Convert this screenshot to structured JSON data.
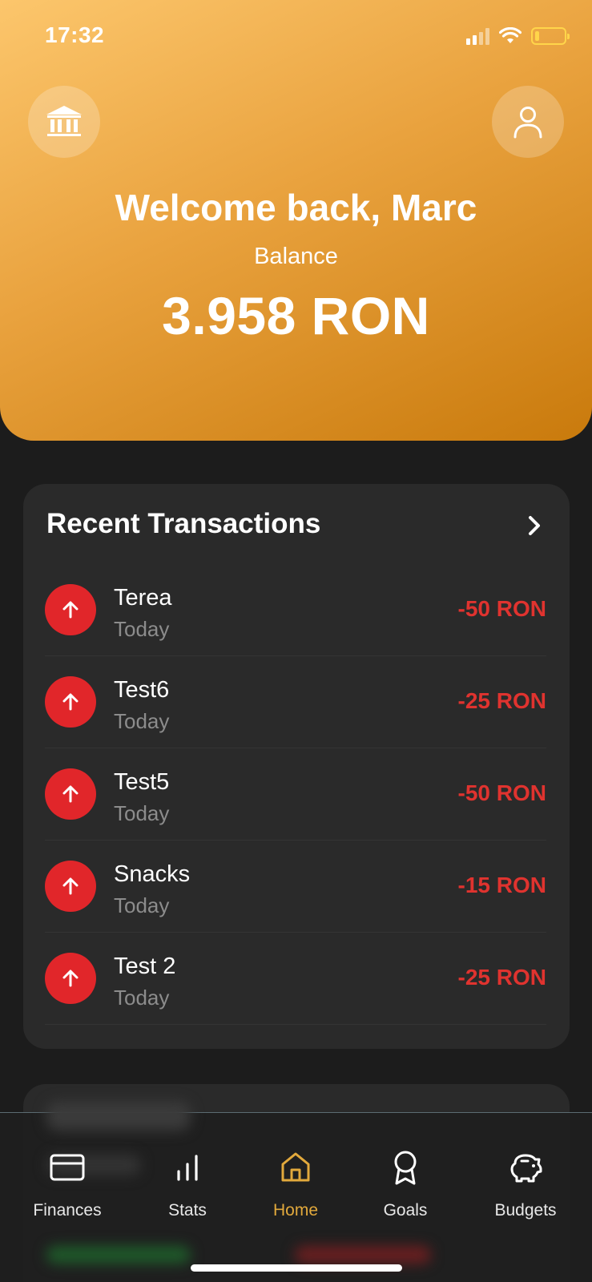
{
  "status_bar": {
    "time": "17:32",
    "signal_icon": "cellular-signal-icon",
    "wifi_icon": "wifi-icon",
    "battery_icon": "battery-low-icon",
    "battery_color": "#ffd54a"
  },
  "header": {
    "bank_icon": "bank-icon",
    "profile_icon": "user-icon",
    "welcome": "Welcome back, Marc",
    "balance_label": "Balance",
    "balance_value": "3.958 RON",
    "gradient_colors": [
      "#fcc66c",
      "#e9a23e",
      "#c97a0c"
    ]
  },
  "transactions": {
    "title": "Recent Transactions",
    "more_icon": "chevron-right-icon",
    "expense_color": "#e1262a",
    "items": [
      {
        "name": "Terea",
        "date": "Today",
        "amount": "-50 RON",
        "icon": "arrow-up-icon"
      },
      {
        "name": "Test6",
        "date": "Today",
        "amount": "-25 RON",
        "icon": "arrow-up-icon"
      },
      {
        "name": "Test5",
        "date": "Today",
        "amount": "-50 RON",
        "icon": "arrow-up-icon"
      },
      {
        "name": "Snacks",
        "date": "Today",
        "amount": "-15 RON",
        "icon": "arrow-up-icon"
      },
      {
        "name": "Test 2",
        "date": "Today",
        "amount": "-25 RON",
        "icon": "arrow-up-icon"
      }
    ]
  },
  "tabbar": {
    "active_color": "#e2a93c",
    "tabs": [
      {
        "label": "Finances",
        "icon": "credit-card-icon"
      },
      {
        "label": "Stats",
        "icon": "bar-chart-icon"
      },
      {
        "label": "Home",
        "icon": "home-icon",
        "active": true
      },
      {
        "label": "Goals",
        "icon": "award-icon"
      },
      {
        "label": "Budgets",
        "icon": "piggy-bank-icon"
      }
    ]
  }
}
